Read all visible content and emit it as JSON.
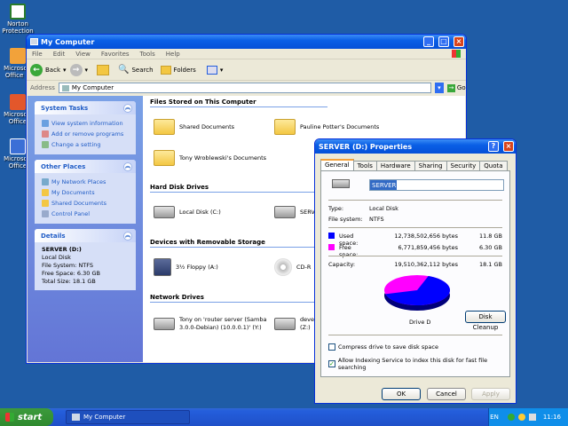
{
  "desktop": {
    "icons": [
      {
        "label": "Norton Protection"
      },
      {
        "label": "Microsoft Office O"
      },
      {
        "label": "Microsoft Office"
      },
      {
        "label": "Microsoft Office"
      }
    ]
  },
  "explorer": {
    "title": "My Computer",
    "menu": [
      "File",
      "Edit",
      "View",
      "Favorites",
      "Tools",
      "Help"
    ],
    "toolbar": {
      "back": "Back",
      "search": "Search",
      "folders": "Folders"
    },
    "address": {
      "label": "Address",
      "value": "My Computer",
      "go": "Go"
    },
    "tasks": {
      "title": "System Tasks",
      "items": [
        "View system information",
        "Add or remove programs",
        "Change a setting"
      ]
    },
    "places": {
      "title": "Other Places",
      "items": [
        "My Network Places",
        "My Documents",
        "Shared Documents",
        "Control Panel"
      ]
    },
    "details": {
      "title": "Details",
      "name": "SERVER (D:)",
      "type": "Local Disk",
      "fs": "File System: NTFS",
      "free": "Free Space: 6.30 GB",
      "total": "Total Size: 18.1 GB"
    },
    "sections": {
      "files": "Files Stored on This Computer",
      "hdd": "Hard Disk Drives",
      "removable": "Devices with Removable Storage",
      "network": "Network Drives"
    },
    "items": {
      "shared": "Shared Documents",
      "pauline": "Pauline Potter's Documents",
      "tony": "Tony Wroblewski's Documents",
      "localc": "Local Disk (C:)",
      "serverd": "SERV",
      "floppy": "3½ Floppy (A:)",
      "cd": "CD-R",
      "net1": "Tony on 'router server (Samba 3.0.0-Debian) (10.0.0.1)' (Y:)",
      "net2": "deve (Z:)"
    }
  },
  "dialog": {
    "title": "SERVER (D:) Properties",
    "tabs": [
      "General",
      "Tools",
      "Hardware",
      "Sharing",
      "Security",
      "Quota"
    ],
    "name": "SERVER",
    "type_label": "Type:",
    "type_value": "Local Disk",
    "fs_label": "File system:",
    "fs_value": "NTFS",
    "used_label": "Used space:",
    "used_bytes": "12,738,502,656 bytes",
    "used_gb": "11.8 GB",
    "free_label": "Free space:",
    "free_bytes": "6,771,859,456 bytes",
    "free_gb": "6.30 GB",
    "cap_label": "Capacity:",
    "cap_bytes": "19,510,362,112 bytes",
    "cap_gb": "18.1 GB",
    "drive_label": "Drive D",
    "cleanup": "Disk Cleanup",
    "compress": "Compress drive to save disk space",
    "index": "Allow Indexing Service to index this disk for fast file searching",
    "ok": "OK",
    "cancel": "Cancel",
    "apply": "Apply",
    "used_fraction": 0.653,
    "colors": {
      "used": "#0000ff",
      "free": "#ff00ff"
    }
  },
  "taskbar": {
    "start": "start",
    "task": "My Computer",
    "lang": "EN",
    "time": "11:16"
  }
}
